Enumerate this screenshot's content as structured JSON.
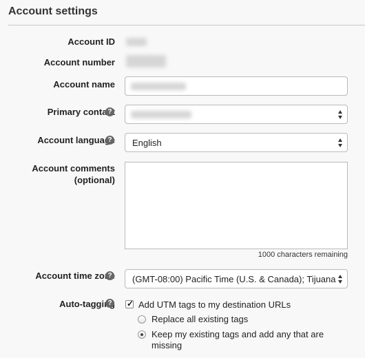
{
  "page": {
    "title": "Account settings"
  },
  "fields": {
    "account_id": {
      "label": "Account ID"
    },
    "account_number": {
      "label": "Account number"
    },
    "account_name": {
      "label": "Account name"
    },
    "primary_contact": {
      "label": "Primary contact",
      "help_icon": "question-circle-icon"
    },
    "account_language": {
      "label": "Account language",
      "value": "English",
      "help_icon": "question-circle-icon"
    },
    "account_comments": {
      "label_line1": "Account comments",
      "label_line2": "(optional)",
      "counter": "1000 characters remaining"
    },
    "time_zone": {
      "label": "Account time zone",
      "value": "(GMT-08:00) Pacific Time (U.S. & Canada); Tijuana",
      "help_icon": "question-circle-icon"
    },
    "auto_tagging": {
      "label": "Auto-tagging",
      "help_icon": "question-circle-icon",
      "checkbox_label": "Add UTM tags to my destination URLs",
      "checkbox_checked": true,
      "options": [
        {
          "label": "Replace all existing tags",
          "selected": false
        },
        {
          "label_line1": "Keep my existing tags and add any that are",
          "label_line2": "missing",
          "selected": true
        }
      ]
    }
  },
  "colors": {
    "background": "#f8f8f8",
    "border": "#b9b9b9",
    "help_icon": "#666666"
  }
}
